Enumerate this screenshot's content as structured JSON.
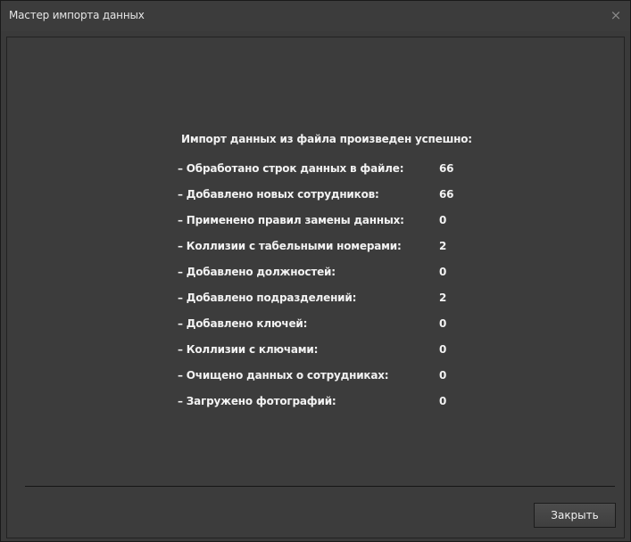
{
  "window": {
    "title": "Мастер импорта данных",
    "close_icon": "×"
  },
  "main": {
    "heading": "Импорт данных из файла произведен успешно:",
    "stats": [
      {
        "label": "– Обработано строк данных в файле:",
        "value": "66"
      },
      {
        "label": "– Добавлено новых сотрудников:",
        "value": "66"
      },
      {
        "label": "– Применено правил замены данных:",
        "value": "0"
      },
      {
        "label": "– Коллизии с табельными номерами:",
        "value": "2"
      },
      {
        "label": "– Добавлено должностей:",
        "value": "0"
      },
      {
        "label": "– Добавлено подразделений:",
        "value": "2"
      },
      {
        "label": "– Добавлено ключей:",
        "value": "0"
      },
      {
        "label": "– Коллизии с ключами:",
        "value": "0"
      },
      {
        "label": "– Очищено данных о сотрудниках:",
        "value": "0"
      },
      {
        "label": "– Загружено фотографий:",
        "value": "0"
      }
    ]
  },
  "footer": {
    "close_button_label": "Закрыть"
  }
}
